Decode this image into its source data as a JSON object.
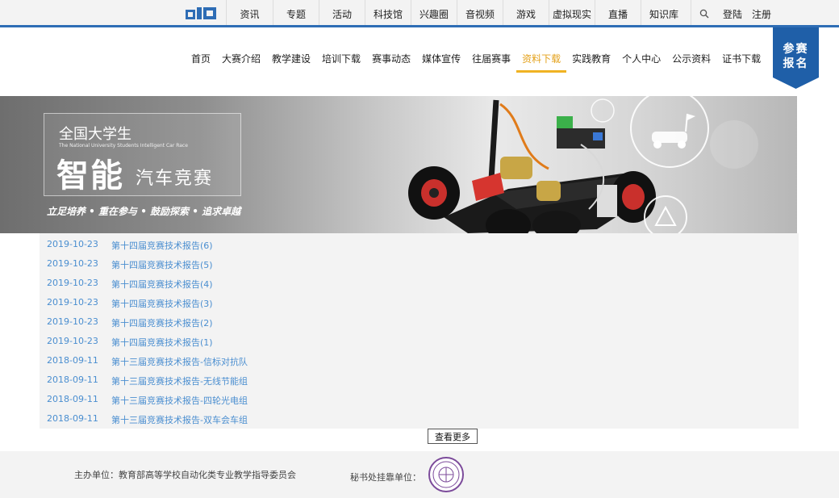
{
  "logo_text": "cid",
  "topnav": [
    {
      "label": "资讯",
      "color": "#e83e5a",
      "width": 58
    },
    {
      "label": "专题",
      "color": "#f0b323",
      "width": 57
    },
    {
      "label": "活动",
      "color": "#2e6db5",
      "width": 57
    },
    {
      "label": "科技馆",
      "color": "#8bb13a",
      "width": 57
    },
    {
      "label": "兴趣圈",
      "color": "#e56bb5",
      "width": 57
    },
    {
      "label": "音视频",
      "color": "#2fa37a",
      "width": 57
    },
    {
      "label": "游戏",
      "color": "#4a8ed0",
      "width": 57
    },
    {
      "label": "虚拟现实",
      "color": "#f0b323",
      "width": 57
    },
    {
      "label": "直播",
      "color": "#8bb13a",
      "width": 57
    },
    {
      "label": "知识库",
      "color": "#2fa37a",
      "width": 57
    }
  ],
  "auth": {
    "login": "登陆",
    "register": "注册"
  },
  "mainnav": [
    {
      "label": "首页"
    },
    {
      "label": "大赛介绍"
    },
    {
      "label": "教学建设"
    },
    {
      "label": "培训下载"
    },
    {
      "label": "赛事动态"
    },
    {
      "label": "媒体宣传"
    },
    {
      "label": "往届赛事"
    },
    {
      "label": "资料下载",
      "active": true
    },
    {
      "label": "实践教育"
    },
    {
      "label": "个人中心"
    },
    {
      "label": "公示资料"
    },
    {
      "label": "证书下载"
    }
  ],
  "badge": {
    "line1": "参赛",
    "line2": "报名",
    "color": "#1f5fa8"
  },
  "banner": {
    "line1": "全国大学生",
    "line2": "The National University Students Intelligent Car Race",
    "line3": "智能",
    "line4": "汽车竞赛",
    "slogan": "立足培养 • 重在参与 • 鼓励探索 • 追求卓越"
  },
  "list": [
    {
      "date": "2019-10-23",
      "title": "第十四届竞赛技术报告(6)"
    },
    {
      "date": "2019-10-23",
      "title": "第十四届竞赛技术报告(5)"
    },
    {
      "date": "2019-10-23",
      "title": "第十四届竞赛技术报告(4)"
    },
    {
      "date": "2019-10-23",
      "title": "第十四届竞赛技术报告(3)"
    },
    {
      "date": "2019-10-23",
      "title": "第十四届竞赛技术报告(2)"
    },
    {
      "date": "2019-10-23",
      "title": "第十四届竞赛技术报告(1)"
    },
    {
      "date": "2018-09-11",
      "title": "第十三届竞赛技术报告-信标对抗队"
    },
    {
      "date": "2018-09-11",
      "title": "第十三届竞赛技术报告-无线节能组"
    },
    {
      "date": "2018-09-11",
      "title": "第十三届竞赛技术报告-四轮光电组"
    },
    {
      "date": "2018-09-11",
      "title": "第十三届竞赛技术报告-双车会车组"
    }
  ],
  "more_label": "查看更多",
  "footer": {
    "organizer": "主办单位：教育部高等学校自动化类专业教学指导委员会",
    "secretariat": "秘书处挂靠单位："
  }
}
